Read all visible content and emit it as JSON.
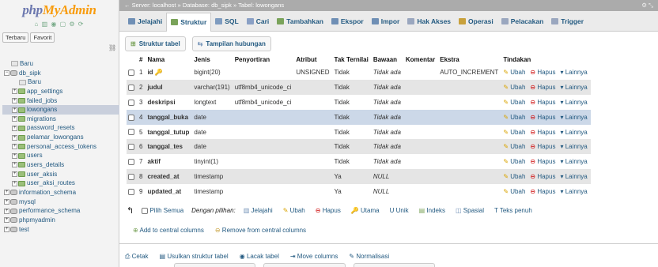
{
  "logo": {
    "part1": "php",
    "part2": "MyAdmin"
  },
  "nav_icons": "⌂ ▥ ◉ ▢ ⚙ ⟳",
  "left_tabs": [
    "Terbaru",
    "Favorit"
  ],
  "link_icon": "⛓",
  "tree": [
    {
      "label": "Baru",
      "level": 0,
      "expander": "",
      "icon": "nw",
      "selected": false
    },
    {
      "label": "db_sipk",
      "level": 0,
      "expander": "−",
      "icon": "db",
      "selected": false
    },
    {
      "label": "Baru",
      "level": 1,
      "expander": "",
      "icon": "nw",
      "selected": false
    },
    {
      "label": "app_settings",
      "level": 1,
      "expander": "+",
      "icon": "tb",
      "selected": false
    },
    {
      "label": "failed_jobs",
      "level": 1,
      "expander": "+",
      "icon": "tb",
      "selected": false
    },
    {
      "label": "lowongans",
      "level": 1,
      "expander": "+",
      "icon": "tb",
      "selected": true
    },
    {
      "label": "migrations",
      "level": 1,
      "expander": "+",
      "icon": "tb",
      "selected": false
    },
    {
      "label": "password_resets",
      "level": 1,
      "expander": "+",
      "icon": "tb",
      "selected": false
    },
    {
      "label": "pelamar_lowongans",
      "level": 1,
      "expander": "+",
      "icon": "tb",
      "selected": false
    },
    {
      "label": "personal_access_tokens",
      "level": 1,
      "expander": "+",
      "icon": "tb",
      "selected": false
    },
    {
      "label": "users",
      "level": 1,
      "expander": "+",
      "icon": "tb",
      "selected": false
    },
    {
      "label": "users_details",
      "level": 1,
      "expander": "+",
      "icon": "tb",
      "selected": false
    },
    {
      "label": "user_aksis",
      "level": 1,
      "expander": "+",
      "icon": "tb",
      "selected": false
    },
    {
      "label": "user_aksi_routes",
      "level": 1,
      "expander": "+",
      "icon": "tb",
      "selected": false
    },
    {
      "label": "information_schema",
      "level": 0,
      "expander": "+",
      "icon": "db",
      "selected": false
    },
    {
      "label": "mysql",
      "level": 0,
      "expander": "+",
      "icon": "db",
      "selected": false
    },
    {
      "label": "performance_schema",
      "level": 0,
      "expander": "+",
      "icon": "db",
      "selected": false
    },
    {
      "label": "phpmyadmin",
      "level": 0,
      "expander": "+",
      "icon": "db",
      "selected": false
    },
    {
      "label": "test",
      "level": 0,
      "expander": "+",
      "icon": "db",
      "selected": false
    }
  ],
  "breadcrumb": {
    "arrow": "←",
    "server": "Server: localhost",
    "db": "Database: db_sipk",
    "table": "Tabel: lowongans",
    "sep": "»",
    "gear": "⚙ ⤡"
  },
  "tabs": [
    {
      "label": "Jelajahi",
      "color": "#6f8fb5",
      "active": false
    },
    {
      "label": "Struktur",
      "color": "#7aa35a",
      "active": true
    },
    {
      "label": "SQL",
      "color": "#7f9cc0",
      "active": false
    },
    {
      "label": "Cari",
      "color": "#8aa0c5",
      "active": false
    },
    {
      "label": "Tambahkan",
      "color": "#7aa35a",
      "active": false
    },
    {
      "label": "Ekspor",
      "color": "#6f8fb5",
      "active": false
    },
    {
      "label": "Impor",
      "color": "#6f8fb5",
      "active": false
    },
    {
      "label": "Hak Akses",
      "color": "#9aa7bf",
      "active": false
    },
    {
      "label": "Operasi",
      "color": "#c8a13c",
      "active": false
    },
    {
      "label": "Pelacakan",
      "color": "#9aa7bf",
      "active": false
    },
    {
      "label": "Trigger",
      "color": "#9aa7bf",
      "active": false
    }
  ],
  "subtabs": [
    "Struktur tabel",
    "Tampilan hubungan"
  ],
  "columns": [
    "#",
    "Nama",
    "Jenis",
    "Penyortiran",
    "Atribut",
    "Tak Ternilai",
    "Bawaan",
    "Komentar",
    "Ekstra",
    "Tindakan"
  ],
  "rows": [
    {
      "num": "1",
      "name": "id",
      "key": true,
      "type": "bigint(20)",
      "collation": "",
      "attr": "UNSIGNED",
      "null": "Tidak",
      "default": "Tidak ada",
      "extra": "AUTO_INCREMENT",
      "hl": false
    },
    {
      "num": "2",
      "name": "judul",
      "key": false,
      "type": "varchar(191)",
      "collation": "utf8mb4_unicode_ci",
      "attr": "",
      "null": "Tidak",
      "default": "Tidak ada",
      "extra": "",
      "hl": false
    },
    {
      "num": "3",
      "name": "deskripsi",
      "key": false,
      "type": "longtext",
      "collation": "utf8mb4_unicode_ci",
      "attr": "",
      "null": "Tidak",
      "default": "Tidak ada",
      "extra": "",
      "hl": false
    },
    {
      "num": "4",
      "name": "tanggal_buka",
      "key": false,
      "type": "date",
      "collation": "",
      "attr": "",
      "null": "Tidak",
      "default": "Tidak ada",
      "extra": "",
      "hl": true
    },
    {
      "num": "5",
      "name": "tanggal_tutup",
      "key": false,
      "type": "date",
      "collation": "",
      "attr": "",
      "null": "Tidak",
      "default": "Tidak ada",
      "extra": "",
      "hl": false
    },
    {
      "num": "6",
      "name": "tanggal_tes",
      "key": false,
      "type": "date",
      "collation": "",
      "attr": "",
      "null": "Tidak",
      "default": "Tidak ada",
      "extra": "",
      "hl": false
    },
    {
      "num": "7",
      "name": "aktif",
      "key": false,
      "type": "tinyint(1)",
      "collation": "",
      "attr": "",
      "null": "Tidak",
      "default": "Tidak ada",
      "extra": "",
      "hl": false
    },
    {
      "num": "8",
      "name": "created_at",
      "key": false,
      "type": "timestamp",
      "collation": "",
      "attr": "",
      "null": "Ya",
      "default": "NULL",
      "extra": "",
      "hl": false
    },
    {
      "num": "9",
      "name": "updated_at",
      "key": false,
      "type": "timestamp",
      "collation": "",
      "attr": "",
      "null": "Ya",
      "default": "NULL",
      "extra": "",
      "hl": false
    }
  ],
  "actions": {
    "edit": "Ubah",
    "drop": "Hapus",
    "more": "Lainnya"
  },
  "bulk": {
    "check_all": "Pilih Semua",
    "with_selected": "Dengan pilihan:",
    "items": [
      "Jelajahi",
      "Ubah",
      "Hapus",
      "Utama",
      "Unik",
      "Indeks",
      "Spasial",
      "Teks penuh"
    ]
  },
  "bulk2": [
    "Add to central columns",
    "Remove from central columns"
  ],
  "footer": [
    "Cetak",
    "Usulkan struktur tabel",
    "Lacak tabel",
    "Move columns",
    "Normalisasi"
  ]
}
